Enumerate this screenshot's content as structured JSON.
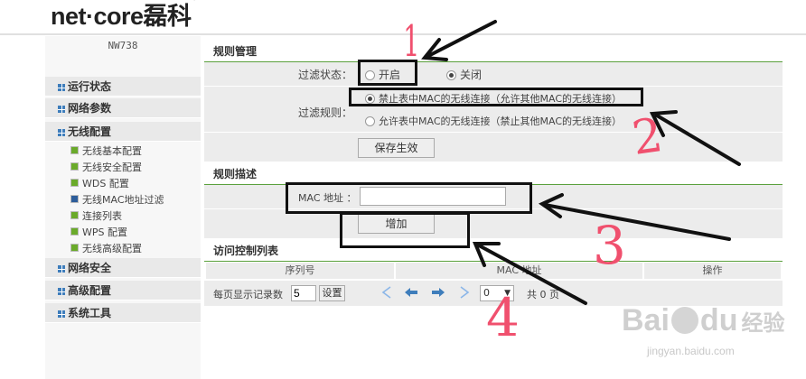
{
  "brand": {
    "logo": "net·core",
    "logo_cn": "磊科",
    "registered": "®"
  },
  "device": {
    "model": "NW738"
  },
  "sidebar": {
    "menus": [
      {
        "label": "运行状态"
      },
      {
        "label": "网络参数"
      },
      {
        "label": "无线配置"
      },
      {
        "label": "网络安全"
      },
      {
        "label": "高级配置"
      },
      {
        "label": "系统工具"
      }
    ],
    "wireless_items": [
      {
        "label": "无线基本配置"
      },
      {
        "label": "无线安全配置"
      },
      {
        "label": "WDS 配置"
      },
      {
        "label": "无线MAC地址过滤"
      },
      {
        "label": "连接列表"
      },
      {
        "label": "WPS 配置"
      },
      {
        "label": "无线高级配置"
      }
    ]
  },
  "rule_management": {
    "title": "规则管理",
    "filter_state_label": "过滤状态：",
    "on_label": "开启",
    "off_label": "关闭",
    "filter_rule_label": "过滤规则：",
    "rule_deny": "禁止表中MAC的无线连接（允许其他MAC的无线连接）",
    "rule_allow": "允许表中MAC的无线连接（禁止其他MAC的无线连接）",
    "save_button": "保存生效"
  },
  "rule_description": {
    "title": "规则描述",
    "mac_label": "MAC 地址 ：",
    "mac_value": "",
    "add_button": "增加"
  },
  "acl": {
    "title": "访问控制列表",
    "columns": [
      "序列号",
      "MAC 地址",
      "操作"
    ],
    "per_page_label": "每页显示记录数",
    "per_page_value": "5",
    "set_button": "设置",
    "page_select": "0",
    "total_prefix": "共",
    "total_count": "0",
    "total_suffix": "页"
  },
  "annotations": {
    "n1": "1",
    "n2": "2",
    "n3": "3",
    "n4": "4"
  },
  "watermark": {
    "brand": "Bai",
    "brand_tail": "du",
    "cn": "经验",
    "url": "jingyan.baidu.com"
  },
  "colors": {
    "accent": "#3e7dbb",
    "rule_line": "#5aa03c",
    "annotation": "#f0506e"
  }
}
